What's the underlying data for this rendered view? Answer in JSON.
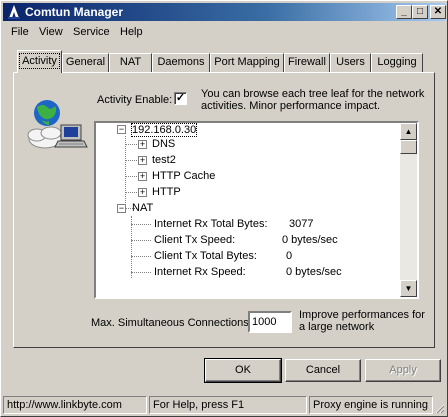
{
  "window": {
    "title": "Comtun Manager",
    "minimize": "_",
    "maximize": "□",
    "close": "✕"
  },
  "menu": [
    "File",
    "View",
    "Service",
    "Help"
  ],
  "tabs": [
    "Activity",
    "General",
    "NAT",
    "Daemons",
    "Port Mapping",
    "Firewall",
    "Users",
    "Logging"
  ],
  "active_tab": "Activity",
  "activity": {
    "enable_label": "Activity Enable:",
    "enable_checked": true,
    "check_mark": "✓",
    "hint": "You can browse each tree leaf for the network activities. Minor performance impact."
  },
  "tree": {
    "root": "192.168.0.30",
    "children": [
      "DNS",
      "test2",
      "HTTP Cache",
      "HTTP"
    ],
    "nat_node": "NAT",
    "nat_stats": [
      {
        "label": "Internet Rx Total Bytes:",
        "value": "3077"
      },
      {
        "label": "Client Tx Speed:",
        "value": "0 bytes/sec"
      },
      {
        "label": "Client Tx Total Bytes:",
        "value": "0"
      },
      {
        "label": "Internet Rx Speed:",
        "value": "0 bytes/sec"
      }
    ],
    "expand_symbol": "+",
    "collapse_symbol": "−"
  },
  "max_connections": {
    "label": "Max. Simultaneous Connections:",
    "value": "1000",
    "hint": "Improve performances for a large network"
  },
  "buttons": {
    "ok": "OK",
    "cancel": "Cancel",
    "apply": "Apply"
  },
  "status": {
    "url": "http://www.linkbyte.com",
    "help": "For Help, press F1",
    "engine": "Proxy engine is running"
  },
  "colors": {
    "face": "#d4d0c8",
    "title_start": "#0a246a",
    "title_end": "#a6caf0"
  },
  "icons": [
    "app-icon",
    "network-computer-icon",
    "scroll-up-icon",
    "scroll-down-icon",
    "size-grip-icon"
  ]
}
